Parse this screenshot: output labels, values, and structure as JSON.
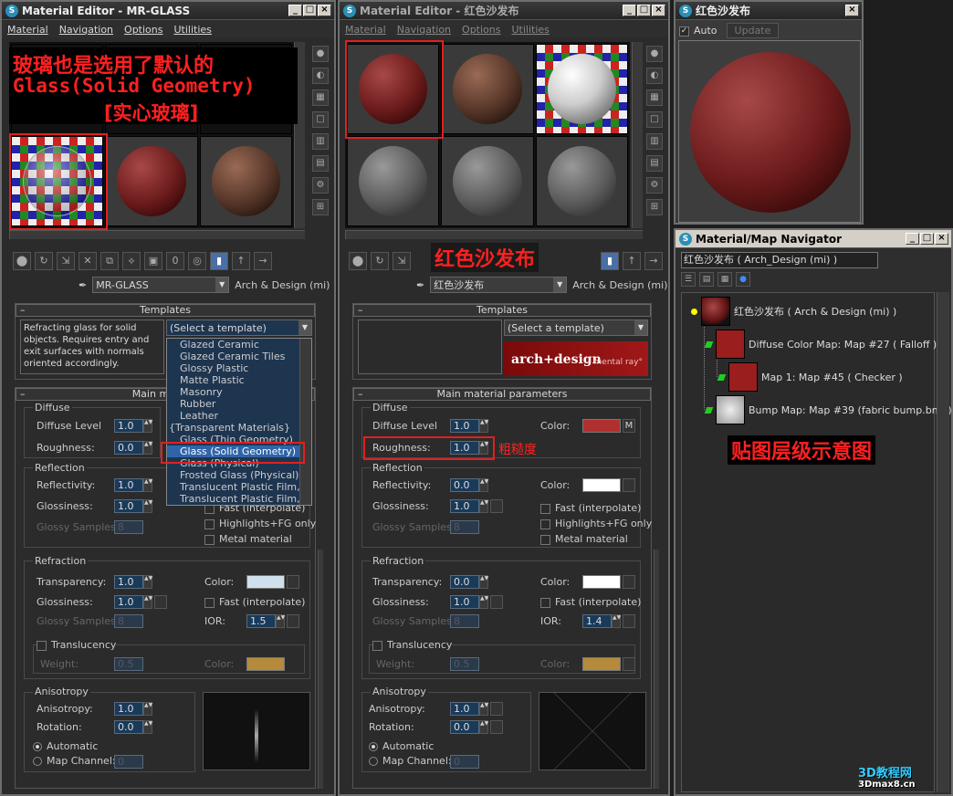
{
  "left_editor": {
    "title": "Material Editor - MR-GLASS",
    "menu": [
      "Material",
      "Navigation",
      "Options",
      "Utilities"
    ],
    "material_name": "MR-GLASS",
    "material_type": "Arch & Design (mi)",
    "templates_header": "Templates",
    "template_description": "Refracting glass for solid objects. Requires entry and exit surfaces with normals oriented accordingly.",
    "template_select": "(Select a template)",
    "template_list": [
      "Glazed Ceramic",
      "Glazed Ceramic Tiles",
      "Glossy Plastic",
      "Matte Plastic",
      "Masonry",
      "Rubber",
      "Leather",
      "{Transparent Materials}",
      "Glass (Thin Geometry)",
      "Glass (Solid Geometry)",
      "Glass (Physical)",
      "Frosted Glass (Physical)",
      "Translucent Plastic Film, Lig",
      "Translucent Plastic Film, Op"
    ],
    "main_header": "Main materia",
    "diffuse": {
      "group": "Diffuse",
      "level_label": "Diffuse Level",
      "level": "1.0",
      "roughness_label": "Roughness:",
      "roughness": "0.0"
    },
    "reflection": {
      "group": "Reflection",
      "reflectivity_label": "Reflectivity:",
      "reflectivity": "1.0",
      "glossiness_label": "Glossiness:",
      "glossiness": "1.0",
      "samples_label": "Glossy Samples",
      "samples": "8",
      "fast": "Fast (interpolate)",
      "highlights": "Highlights+FG only",
      "metal": "Metal material"
    },
    "refraction": {
      "group": "Refraction",
      "transparency_label": "Transparency:",
      "transparency": "1.0",
      "glossiness_label": "Glossiness:",
      "glossiness": "1.0",
      "samples_label": "Glossy Samples",
      "samples": "8",
      "color_label": "Color:",
      "fast": "Fast (interpolate)",
      "ior_label": "IOR:",
      "ior": "1.5",
      "translucency": "Translucency",
      "weight_label": "Weight:",
      "weight": "0.5",
      "tcolor_label": "Color:"
    },
    "anisotropy": {
      "group": "Anisotropy",
      "anisotropy_label": "Anisotropy:",
      "anisotropy": "1.0",
      "rotation_label": "Rotation:",
      "rotation": "0.0",
      "automatic": "Automatic",
      "map_channel": "Map Channel:",
      "channel": "0"
    },
    "annotation_lines": [
      "玻璃也是选用了默认的",
      "Glass(Solid Geometry)",
      "[实心玻璃]"
    ],
    "colors": {
      "refraction_color": "#cfe0ec",
      "translucency_color": "#b58a3a"
    }
  },
  "middle_editor": {
    "title": "Material Editor - 红色沙发布",
    "menu": [
      "Material",
      "Navigation",
      "Options",
      "Utilities"
    ],
    "material_name": "红色沙发布",
    "material_type": "Arch & Design (mi)",
    "annotation_name": "红色沙发布",
    "templates_header": "Templates",
    "template_select": "(Select a template)",
    "brand": "arch+design",
    "brand_sub": "mental ray°",
    "main_header": "Main material parameters",
    "diffuse": {
      "group": "Diffuse",
      "level_label": "Diffuse Level",
      "level": "1.0",
      "roughness_label": "Roughness:",
      "roughness": "1.0",
      "color_label": "Color:",
      "map_flag": "M"
    },
    "roughness_note": "粗糙度",
    "reflection": {
      "group": "Reflection",
      "reflectivity_label": "Reflectivity:",
      "reflectivity": "0.0",
      "glossiness_label": "Glossiness:",
      "glossiness": "1.0",
      "samples_label": "Glossy Samples",
      "samples": "8",
      "color_label": "Color:",
      "fast": "Fast (interpolate)",
      "highlights": "Highlights+FG only",
      "metal": "Metal material"
    },
    "refraction": {
      "group": "Refraction",
      "transparency_label": "Transparency:",
      "transparency": "0.0",
      "glossiness_label": "Glossiness:",
      "glossiness": "1.0",
      "samples_label": "Glossy Samples",
      "samples": "8",
      "color_label": "Color:",
      "fast": "Fast (interpolate)",
      "ior_label": "IOR:",
      "ior": "1.4",
      "translucency": "Translucency",
      "weight_label": "Weight:",
      "weight": "0.5",
      "tcolor_label": "Color:"
    },
    "anisotropy": {
      "group": "Anisotropy",
      "anisotropy_label": "Anisotropy:",
      "anisotropy": "1.0",
      "rotation_label": "Rotation:",
      "rotation": "0.0",
      "automatic": "Automatic",
      "map_channel": "Map Channel:",
      "channel": "0"
    },
    "colors": {
      "diffuse_color": "#b03030",
      "reflection_color": "#ffffff",
      "refraction_color": "#ffffff",
      "translucency_color": "#b58a3a"
    }
  },
  "preview": {
    "title": "红色沙发布",
    "auto": "Auto",
    "update": "Update"
  },
  "navigator": {
    "title": "Material/Map Navigator",
    "path": "红色沙发布  ( Arch_Design (mi) )",
    "items": [
      {
        "label": "红色沙发布  ( Arch & Design (mi) )"
      },
      {
        "label": "Diffuse Color Map: Map #27  ( Falloff )"
      },
      {
        "label": "Map 1: Map #45  ( Checker )"
      },
      {
        "label": "Bump Map: Map #39 (fabric bump.bmp)"
      }
    ],
    "annotation": "贴图层级示意图"
  },
  "watermark": {
    "site": "3D教程网",
    "url": "3Dmax8.cn"
  }
}
